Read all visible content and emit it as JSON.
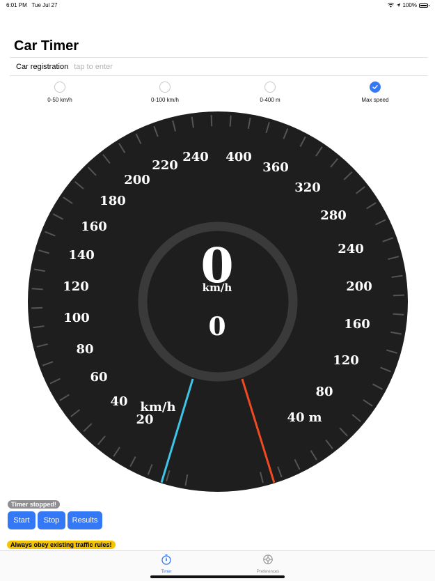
{
  "status_bar": {
    "time": "6:01 PM",
    "date": "Tue Jul 27",
    "battery": "100%"
  },
  "header": {
    "title": "Car Timer"
  },
  "registration": {
    "label": "Car registration",
    "placeholder": "tap to enter",
    "value": ""
  },
  "modes": [
    {
      "label": "0-50 km/h",
      "selected": false
    },
    {
      "label": "0-100 km/h",
      "selected": false
    },
    {
      "label": "0-400 m",
      "selected": false
    },
    {
      "label": "Max speed",
      "selected": true
    }
  ],
  "speedometer": {
    "speed_value": "0",
    "speed_unit": "km/h",
    "distance_value": "0",
    "left_scale_unit": "km/h",
    "right_scale_unit": "m",
    "left_scale": [
      "20",
      "40",
      "60",
      "80",
      "100",
      "120",
      "140",
      "160",
      "180",
      "200",
      "220",
      "240"
    ],
    "right_scale": [
      "40",
      "80",
      "120",
      "160",
      "200",
      "240",
      "280",
      "320",
      "360",
      "400"
    ],
    "left_needle_color": "#3ec6e8",
    "right_needle_color": "#f04a22"
  },
  "timer": {
    "status": "Timer stopped!"
  },
  "controls": {
    "start": "Start",
    "stop": "Stop",
    "results": "Results"
  },
  "warning": {
    "text": "Always obey existing traffic rules!"
  },
  "tab_bar": {
    "tabs": [
      {
        "label": "Timer",
        "icon": "stopwatch-icon",
        "active": true
      },
      {
        "label": "Preferences",
        "icon": "gear-icon",
        "active": false
      }
    ]
  },
  "colors": {
    "accent": "#3478f6",
    "gauge_bg": "#1e1e1e",
    "badge_gray": "#8e8e93",
    "warning_yellow": "#f5c400"
  }
}
